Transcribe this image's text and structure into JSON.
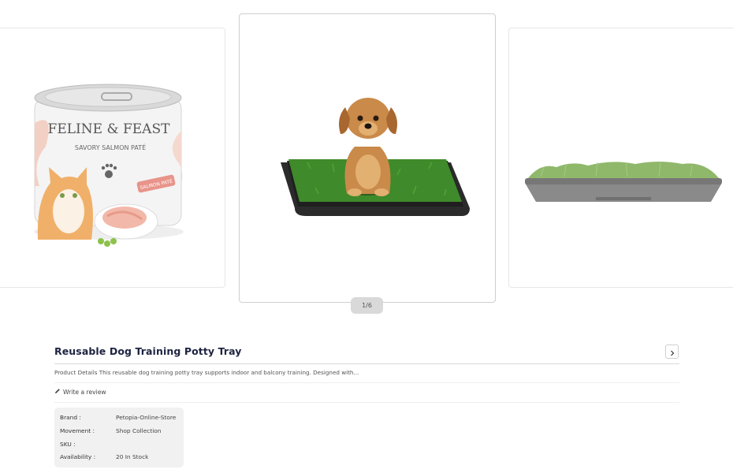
{
  "carousel": {
    "pager_text": "1/6",
    "left_product": {
      "brand_text": "FELINE & FEAST",
      "subtitle_text": "SAVORY SALMON PATÉ",
      "tag_text": "SALMON PATÉ"
    }
  },
  "product": {
    "title": "Reusable Dog Training Potty Tray",
    "details": "Product Details This reusable dog training potty tray supports indoor and balcony training. Designed with...",
    "write_review": "Write a review",
    "specs": [
      {
        "label": "Brand :",
        "value": "Petopia-Online-Store"
      },
      {
        "label": "Movement :",
        "value": "Shop Collection"
      },
      {
        "label": "SKU :",
        "value": ""
      },
      {
        "label": "Availability :",
        "value": "20 In Stock"
      }
    ]
  },
  "colors": {
    "title": "#1d2340",
    "grass": "#3f8a2a",
    "tray": "#2b2b2b",
    "puppy": "#c98a4a"
  }
}
